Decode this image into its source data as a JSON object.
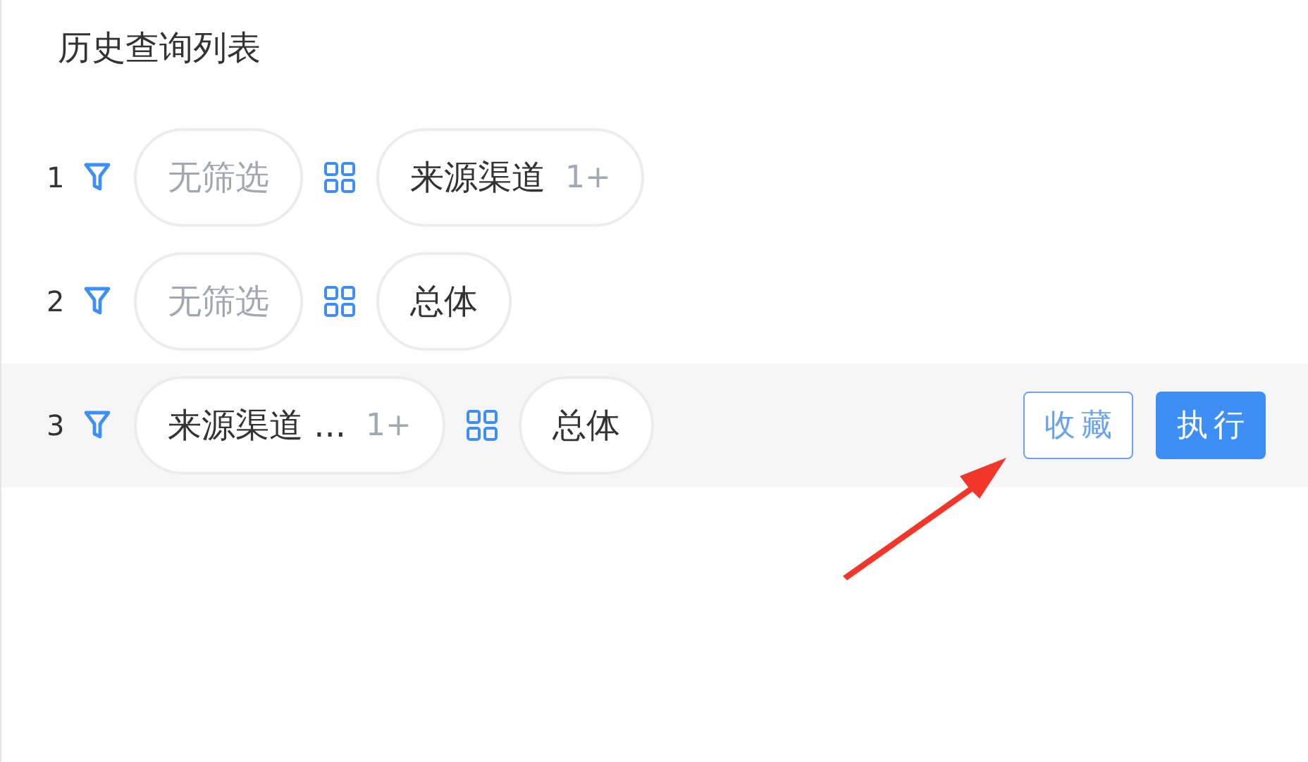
{
  "title": "历史查询列表",
  "rows": [
    {
      "index": "1",
      "selected": false,
      "filter": {
        "text": "无筛选",
        "empty": true
      },
      "dimension": {
        "text": "来源渠道",
        "count": "1+"
      }
    },
    {
      "index": "2",
      "selected": false,
      "filter": {
        "text": "无筛选",
        "empty": true
      },
      "dimension": {
        "text": "总体"
      }
    },
    {
      "index": "3",
      "selected": true,
      "filter": {
        "text": "来源渠道 ...",
        "empty": false,
        "count": "1+"
      },
      "dimension": {
        "text": "总体"
      }
    }
  ],
  "row_actions": [
    {
      "label": "收藏",
      "kind": "outline"
    },
    {
      "label": "执行",
      "kind": "primary"
    }
  ]
}
